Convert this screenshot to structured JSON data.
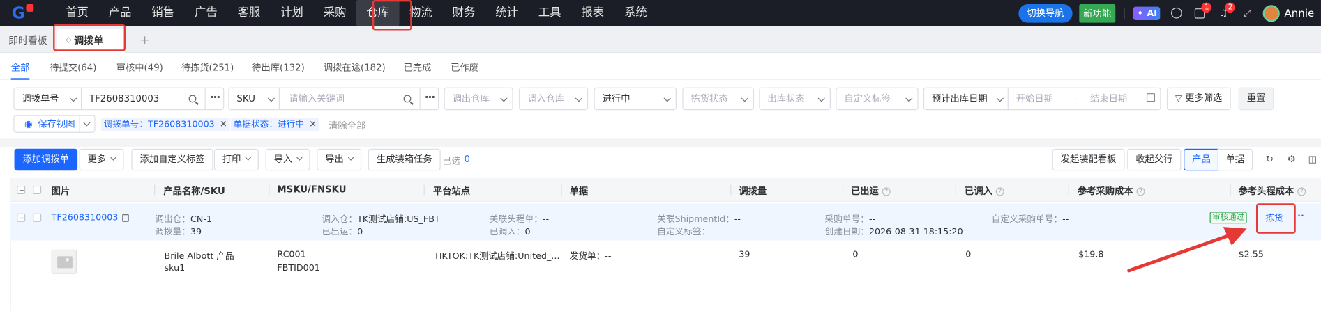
{
  "topnav": {
    "logo": "G",
    "items": [
      "首页",
      "产品",
      "销售",
      "广告",
      "客服",
      "计划",
      "采购",
      "仓库",
      "物流",
      "财务",
      "统计",
      "工具",
      "报表",
      "系统"
    ],
    "active": "仓库",
    "switch_nav": "切换导航",
    "new_feature": "新功能",
    "ai": "AI",
    "notif1": "1",
    "notif2": "2",
    "user": "Annie"
  },
  "tabs": {
    "dashboard": "即时看板",
    "current": "调拨单",
    "plus": "+"
  },
  "status_tabs": [
    "全部",
    "待提交(64)",
    "审核中(49)",
    "待拣货(251)",
    "待出库(132)",
    "调拨在途(182)",
    "已完成",
    "已作废"
  ],
  "filters": {
    "order_type": "调拨单号",
    "order_value": "TF2608310003",
    "sku_type": "SKU",
    "sku_placeholder": "请输入关键词",
    "out_wh": "调出仓库",
    "in_wh": "调入仓库",
    "progress": "进行中",
    "pick_status": "拣货状态",
    "out_status": "出库状态",
    "custom_tag": "自定义标签",
    "date_type": "预计出库日期",
    "start_date": "开始日期",
    "date_sep": "-",
    "end_date": "结束日期",
    "more_filter": "更多筛选",
    "reset": "重置",
    "save_view": "保存视图",
    "tag1": "调拨单号：TF2608310003",
    "tag2": "单据状态：进行中",
    "clear_all": "清除全部"
  },
  "toolbar": {
    "add": "添加调拨单",
    "more": "更多",
    "add_tag": "添加自定义标签",
    "print": "打印",
    "import": "导入",
    "export": "导出",
    "gen_task": "生成装箱任务",
    "selected_label": "已选",
    "selected_count": "0",
    "assemble": "发起装配看板",
    "collapse": "收起父行",
    "view_product": "产品",
    "view_doc": "单据"
  },
  "columns": [
    "图片",
    "产品名称/SKU",
    "MSKU/FNSKU",
    "平台站点",
    "单据",
    "调拨量",
    "已出运",
    "已调入",
    "参考采购成本",
    "参考头程成本"
  ],
  "order": {
    "id": "TF2608310003",
    "out_wh_label": "调出仓：",
    "out_wh": "CN-1",
    "qty_label": "调拨量：",
    "qty": "39",
    "in_wh_label": "调入仓：",
    "in_wh": "TK测试店铺:US_FBT",
    "shipped_label": "已出运：",
    "shipped": "0",
    "head_label": "关联头程单：",
    "head": "--",
    "in_label": "已调入：",
    "in_qty": "0",
    "ship_id_label": "关联ShipmentId：",
    "ship_id": "--",
    "ctag_label": "自定义标签：",
    "ctag": "--",
    "po_label": "采购单号：",
    "po": "--",
    "created_label": "创建日期：",
    "created": "2026-08-31 18:15:20",
    "cpo_label": "自定义采购单号：",
    "cpo": "--",
    "status": "审核通过",
    "pick": "拣货"
  },
  "item": {
    "name": "Brile Albott 产品",
    "sku": "sku1",
    "msku": "RC001",
    "fnsku": "FBTID001",
    "site": "TIKTOK:TK测试店铺:United_...",
    "doc_label": "发货单：",
    "doc": "--",
    "qty": "39",
    "shipped": "0",
    "in_qty": "0",
    "po_cost": "$19.8",
    "head_cost": "$2.55"
  },
  "colors": {
    "nav_bg": "#1b1e26",
    "accent": "#1a66ff",
    "highlight": "#e53935",
    "approved": "#34a853"
  }
}
